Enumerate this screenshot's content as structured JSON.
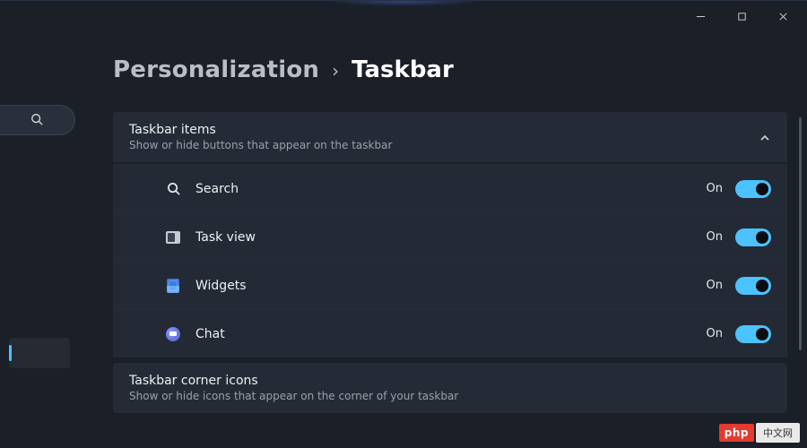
{
  "breadcrumb": {
    "parent": "Personalization",
    "separator": "›",
    "current": "Taskbar"
  },
  "sections": {
    "taskbar_items": {
      "title": "Taskbar items",
      "subtitle": "Show or hide buttons that appear on the taskbar",
      "expanded": true,
      "items": [
        {
          "icon": "search-icon",
          "label": "Search",
          "state": "On",
          "on": true
        },
        {
          "icon": "taskview-icon",
          "label": "Task view",
          "state": "On",
          "on": true
        },
        {
          "icon": "widgets-icon",
          "label": "Widgets",
          "state": "On",
          "on": true
        },
        {
          "icon": "chat-icon",
          "label": "Chat",
          "state": "On",
          "on": true
        }
      ]
    },
    "corner_icons": {
      "title": "Taskbar corner icons",
      "subtitle": "Show or hide icons that appear on the corner of your taskbar",
      "expanded": false
    }
  },
  "watermark": {
    "left": "php",
    "right": "中文网"
  }
}
